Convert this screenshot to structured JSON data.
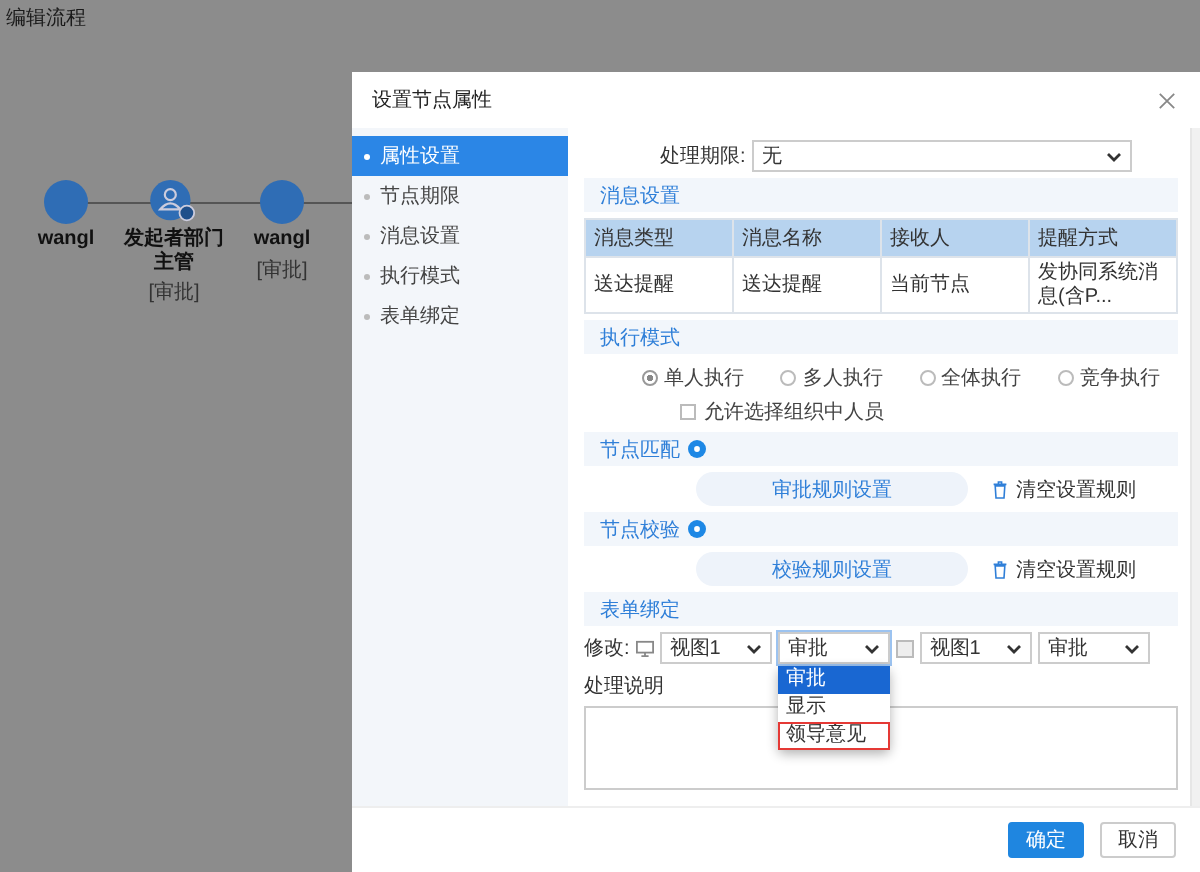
{
  "page_title": "编辑流程",
  "flow": {
    "nodes": [
      {
        "kind": "circle",
        "name": "wangl"
      },
      {
        "kind": "person",
        "name": "发起者部门主管",
        "tag": "[审批]"
      },
      {
        "kind": "circle",
        "name": "wangl",
        "tag": "[审批]"
      }
    ]
  },
  "dialog": {
    "title": "设置节点属性",
    "nav": [
      {
        "label": "属性设置",
        "selected": true
      },
      {
        "label": "节点期限",
        "selected": false
      },
      {
        "label": "消息设置",
        "selected": false
      },
      {
        "label": "执行模式",
        "selected": false
      },
      {
        "label": "表单绑定",
        "selected": false
      }
    ],
    "deadline": {
      "label": "处理期限:",
      "value": "无"
    },
    "message_section": {
      "title": "消息设置",
      "columns": [
        "消息类型",
        "消息名称",
        "接收人",
        "提醒方式"
      ],
      "rows": [
        [
          "送达提醒",
          "送达提醒",
          "当前节点",
          "发协同系统消息(含P..."
        ]
      ]
    },
    "exec_section": {
      "title": "执行模式",
      "options": [
        {
          "label": "单人执行",
          "selected": true
        },
        {
          "label": "多人执行",
          "selected": false
        },
        {
          "label": "全体执行",
          "selected": false
        },
        {
          "label": "竞争执行",
          "selected": false
        }
      ],
      "allow_org": {
        "label": "允许选择组织中人员",
        "checked": false
      }
    },
    "match_section": {
      "title": "节点匹配",
      "button": "审批规则设置",
      "clear": "清空设置规则"
    },
    "verify_section": {
      "title": "节点校验",
      "button": "校验规则设置",
      "clear": "清空设置规则"
    },
    "form_section": {
      "title": "表单绑定",
      "label": "修改:",
      "selects": [
        {
          "value": "视图1",
          "expanded": false
        },
        {
          "value": "审批",
          "expanded": true
        },
        {
          "value": "视图1",
          "expanded": false
        },
        {
          "value": "审批",
          "expanded": false
        }
      ],
      "dropdown": [
        {
          "label": "审批",
          "selected": true,
          "highlighted": false
        },
        {
          "label": "显示",
          "selected": false,
          "highlighted": false
        },
        {
          "label": "领导意见",
          "selected": false,
          "highlighted": true
        }
      ]
    },
    "notes": {
      "label": "处理说明"
    },
    "buttons": [
      {
        "label": "确定",
        "kind": "primary"
      },
      {
        "label": "取消",
        "kind": "default"
      }
    ]
  }
}
